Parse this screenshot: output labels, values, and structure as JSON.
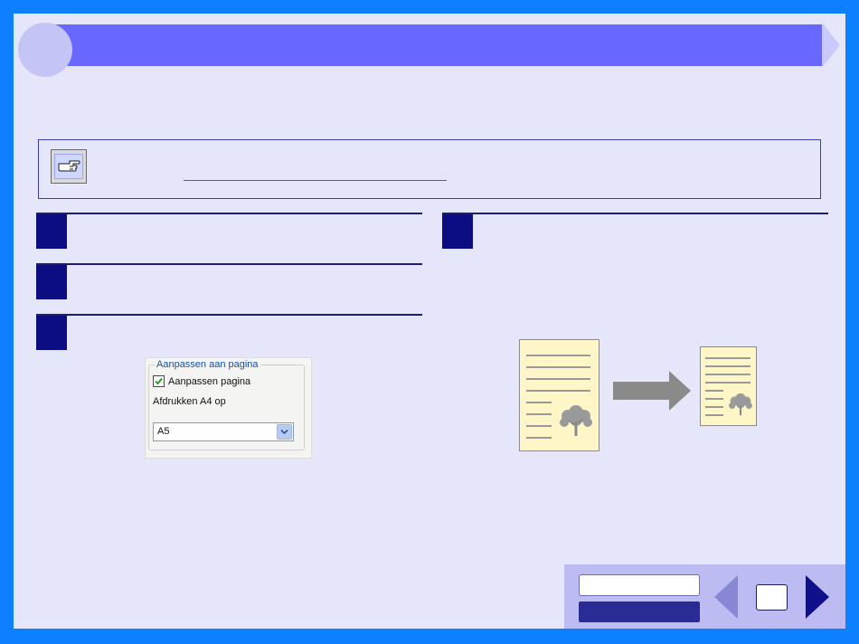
{
  "dialog": {
    "group_legend": "Aanpassen aan pagina",
    "checkbox_label": "Aanpassen pagina",
    "checkbox_checked": true,
    "print_label": "Afdrukken A4 op",
    "select_value": "A5"
  },
  "icons": {
    "note": "pointing-hand-icon",
    "dropdown": "chevron-down-icon",
    "tree": "tree-icon",
    "arrow": "right-arrow-icon"
  },
  "colors": {
    "frame": "#0d80ff",
    "page_bg": "#e6e6fb",
    "title_bar": "#6868ff",
    "step_number": "#0d0d82",
    "paper": "#fff6c8",
    "link_underline": "#119911"
  }
}
